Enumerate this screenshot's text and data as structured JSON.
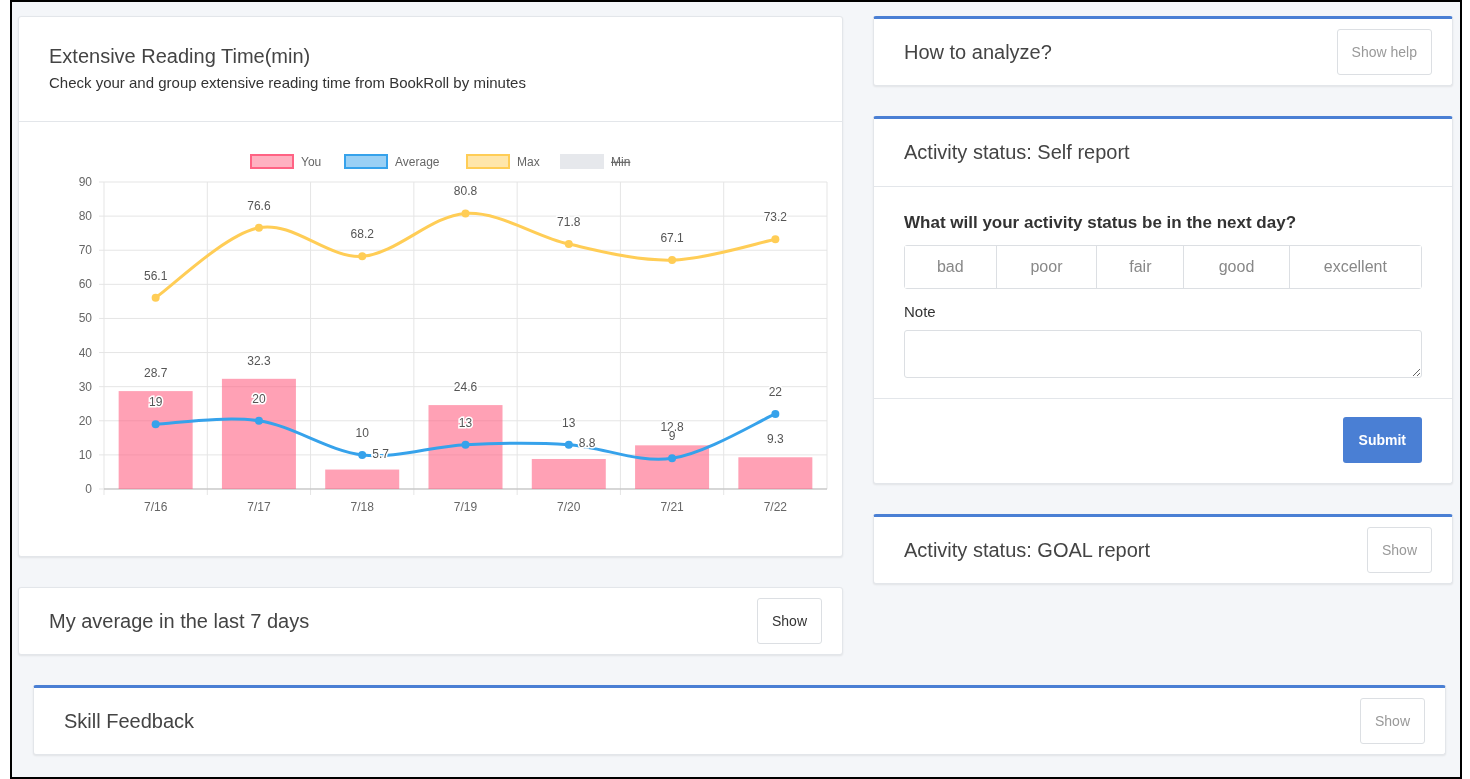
{
  "reading_card": {
    "title": "Extensive Reading Time(min)",
    "subtitle": "Check your and group extensive reading time from BookRoll by minutes",
    "hidden_legend": [
      {
        "label": "Min",
        "color": "#e6e8ec",
        "hidden": true
      }
    ],
    "chart_data": {
      "type": "bar",
      "categories": [
        "7/16",
        "7/17",
        "7/18",
        "7/19",
        "7/20",
        "7/21",
        "7/22"
      ],
      "ylim": [
        0,
        90
      ],
      "yticks": [
        0,
        10,
        20,
        30,
        40,
        50,
        60,
        70,
        80,
        90
      ],
      "data_labels": true,
      "stacked": false,
      "grid": true,
      "legend": true,
      "series": [
        {
          "name": "You",
          "color": "#ff6384",
          "values": [
            28.7,
            32.3,
            5.7,
            24.6,
            8.8,
            12.8,
            9.3
          ]
        },
        {
          "name": "Average",
          "type": "line",
          "marker": true,
          "color": "#36a2eb",
          "values": [
            19,
            20,
            10,
            13,
            13,
            9,
            22
          ]
        },
        {
          "name": "Max",
          "type": "line",
          "marker": true,
          "color": "#ffcd56",
          "values": [
            56.1,
            76.6,
            68.2,
            80.8,
            71.8,
            67.1,
            73.2
          ]
        }
      ]
    }
  },
  "average_card": {
    "title": "My average in the last 7 days",
    "button": "Show"
  },
  "help_card": {
    "title": "How to analyze?",
    "button": "Show help"
  },
  "self_report": {
    "title": "Activity status: Self report",
    "question": "What will your activity status be in the next day?",
    "options": [
      {
        "label": "bad",
        "selected": false
      },
      {
        "label": "poor",
        "selected": false
      },
      {
        "label": "fair",
        "selected": false
      },
      {
        "label": "good",
        "selected": false
      },
      {
        "label": "excellent",
        "selected": false
      }
    ],
    "note_label": "Note",
    "submit": "Submit"
  },
  "goal_card": {
    "title": "Activity status: GOAL report",
    "button": "Show"
  },
  "skill_card": {
    "title": "Skill Feedback",
    "button": "Show"
  }
}
